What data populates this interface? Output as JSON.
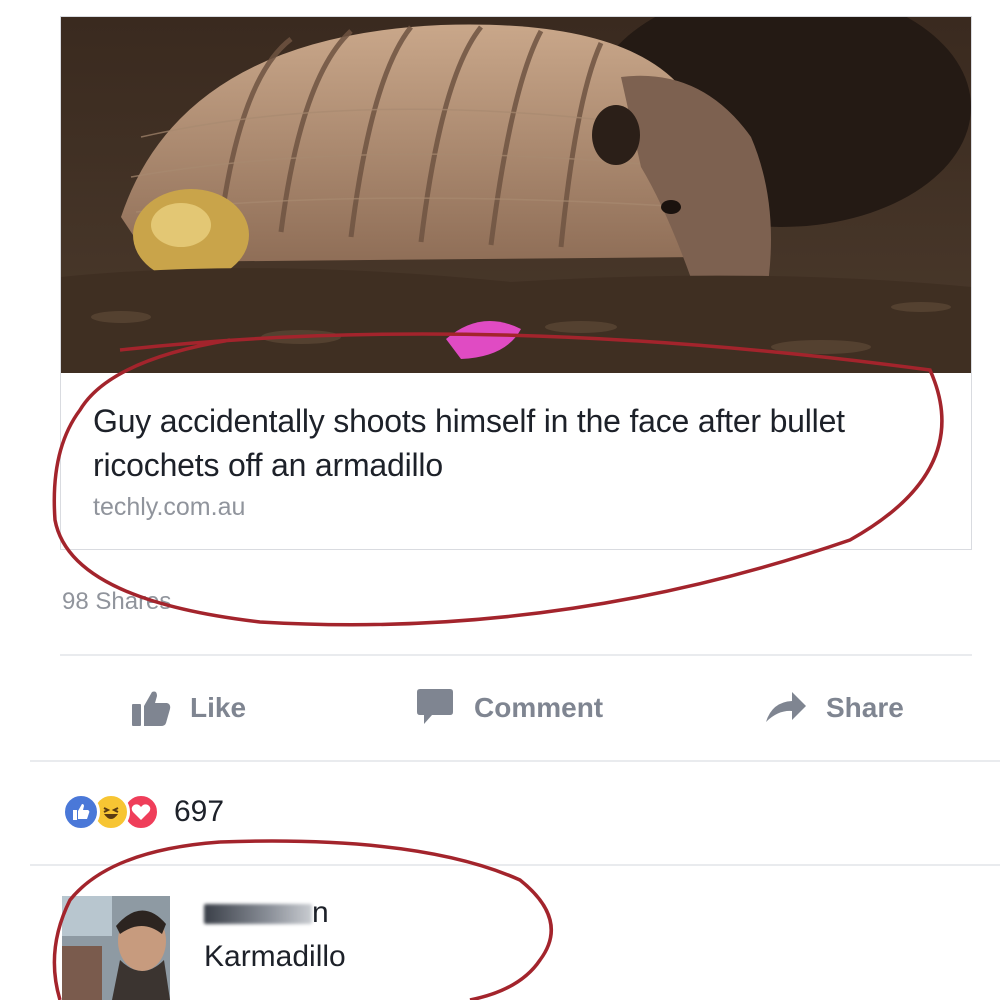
{
  "post": {
    "link_title": "Guy accidentally shoots himself in the face after bullet ricochets off an armadillo",
    "link_domain": "techly.com.au",
    "share_count_label": "98 Shares"
  },
  "actions": {
    "like_label": "Like",
    "comment_label": "Comment",
    "share_label": "Share"
  },
  "reactions": {
    "icons": [
      "like-reaction",
      "haha-reaction",
      "love-reaction"
    ],
    "count": "697"
  },
  "comment": {
    "author_visible_suffix": "n",
    "text": "Karmadillo"
  },
  "colors": {
    "annotation_red": "#a3242c",
    "like_blue": "#4a78d8",
    "love_red": "#ef3e5a",
    "haha_yellow": "#f7c533"
  }
}
